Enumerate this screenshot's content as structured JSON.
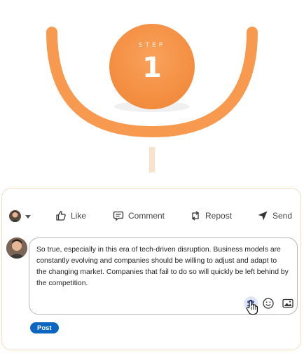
{
  "step": {
    "label": "STEP",
    "number": "1"
  },
  "actions": {
    "like": "Like",
    "comment": "Comment",
    "repost": "Repost",
    "send": "Send"
  },
  "comment": {
    "text": "So true, especially in this era of tech-driven disruption. Business models are constantly evolving and companies should be willing to adjust and adapt to the changing market. Companies that fail to do so will quickly be left behind by the competition."
  },
  "post_button": "Post",
  "colors": {
    "orange": "#f79a4f",
    "accent_blue": "#0a66c2",
    "card_border": "#f7dcc1"
  },
  "icons": [
    "avatar",
    "chevron-down-icon",
    "like-icon",
    "comment-icon",
    "repost-icon",
    "send-icon",
    "mention-icon",
    "emoji-icon",
    "image-icon",
    "hand-cursor-icon"
  ]
}
